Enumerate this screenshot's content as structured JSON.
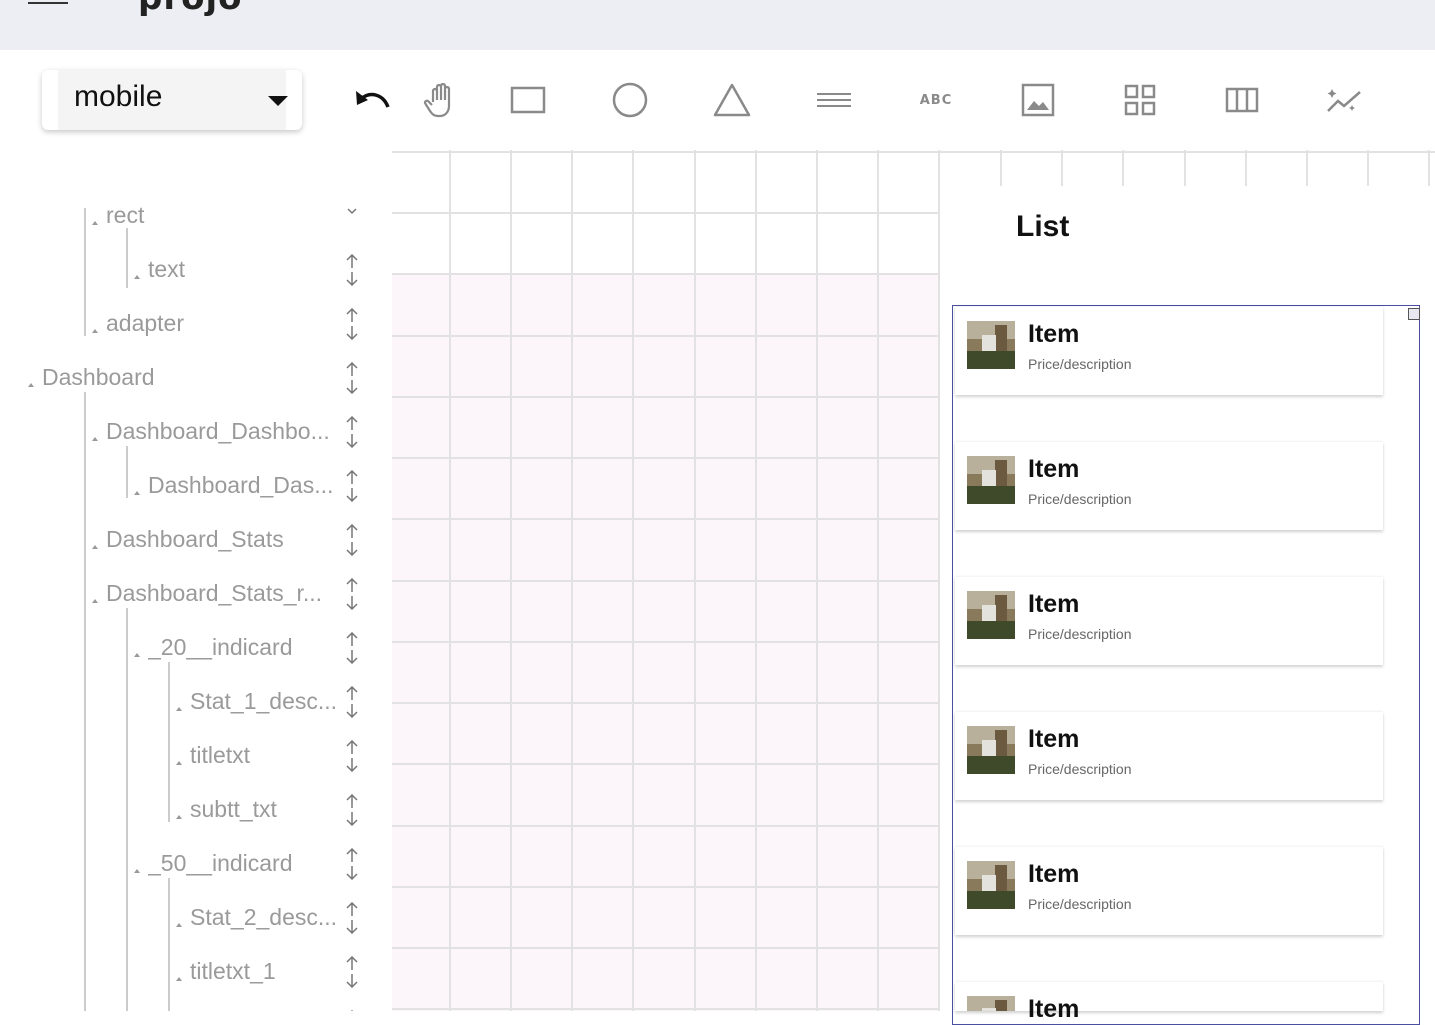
{
  "app": {
    "title": "projo"
  },
  "toolbar": {
    "device": "mobile",
    "tools": [
      {
        "name": "undo-icon"
      },
      {
        "name": "hand-pan-icon"
      },
      {
        "name": "rectangle-tool-icon"
      },
      {
        "name": "circle-tool-icon"
      },
      {
        "name": "triangle-tool-icon"
      },
      {
        "name": "line-tool-icon"
      },
      {
        "name": "text-tool-icon",
        "label": "ABC"
      },
      {
        "name": "image-tool-icon"
      },
      {
        "name": "grid-tool-icon"
      },
      {
        "name": "columns-tool-icon"
      },
      {
        "name": "magic-chart-icon"
      },
      {
        "name": "more-tool-icon"
      }
    ]
  },
  "tree": {
    "rows": [
      {
        "label": "rect"
      },
      {
        "label": "text"
      },
      {
        "label": "adapter"
      },
      {
        "label": "Dashboard"
      },
      {
        "label": "Dashboard_Dashbo..."
      },
      {
        "label": "Dashboard_Das..."
      },
      {
        "label": "Dashboard_Stats"
      },
      {
        "label": "Dashboard_Stats_r..."
      },
      {
        "label": "_20__indicard"
      },
      {
        "label": "Stat_1_desc..."
      },
      {
        "label": "titletxt"
      },
      {
        "label": "subtt_txt"
      },
      {
        "label": "_50__indicard"
      },
      {
        "label": "Stat_2_desc..."
      },
      {
        "label": "titletxt_1"
      }
    ]
  },
  "preview": {
    "list_title": "List",
    "items": [
      {
        "title": "Item",
        "subtitle": "Price/description"
      },
      {
        "title": "Item",
        "subtitle": "Price/description"
      },
      {
        "title": "Item",
        "subtitle": "Price/description"
      },
      {
        "title": "Item",
        "subtitle": "Price/description"
      },
      {
        "title": "Item",
        "subtitle": "Price/description"
      },
      {
        "title": "Item",
        "subtitle": ""
      }
    ]
  }
}
